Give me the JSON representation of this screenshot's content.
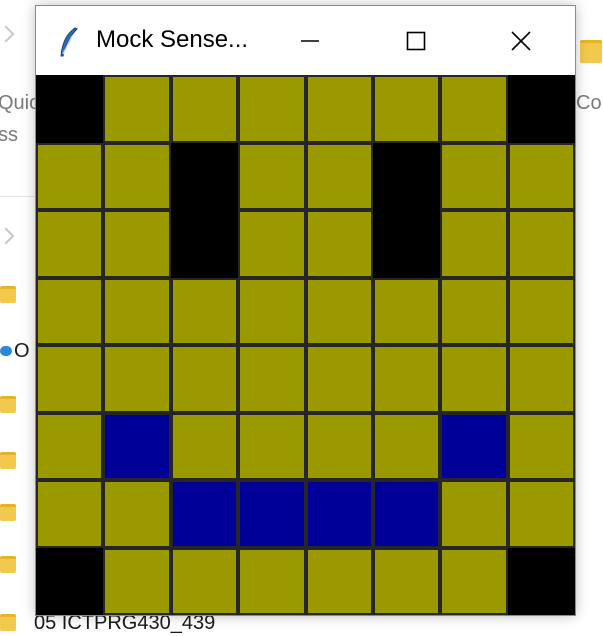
{
  "background": {
    "left_fragments": [
      "Quic",
      "ss",
      "O"
    ],
    "bottom_item": "05 ICTPRG430_439",
    "right_fragment": "Cor"
  },
  "window": {
    "title": "Mock Sense...",
    "minimize_icon": "minimize-icon",
    "maximize_icon": "maximize-icon",
    "close_icon": "close-icon"
  },
  "led_matrix": {
    "rows": 8,
    "cols": 8,
    "colors": {
      "Y": "#9a9900",
      "K": "#000000",
      "B": "#000099"
    },
    "pixels": [
      "KYYYYYYK",
      "YYKYYKYY",
      "YYKYYKYY",
      "YYYYYYYY",
      "YYYYYYYY",
      "YBYYYYBY",
      "YYBBBBYY",
      "KYYYYYYK"
    ]
  }
}
